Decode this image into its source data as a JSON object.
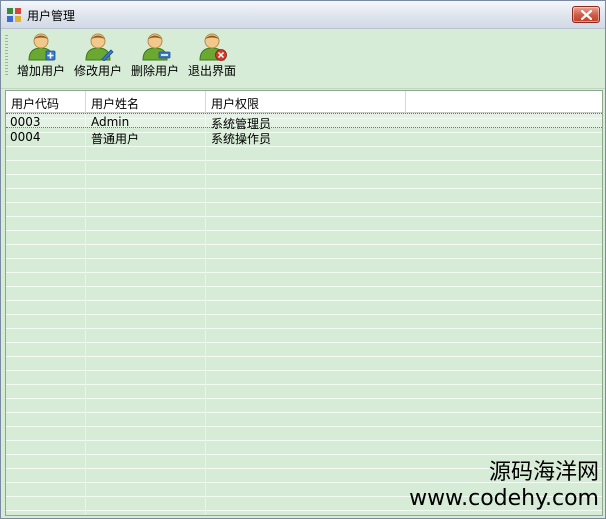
{
  "window": {
    "title": "用户管理"
  },
  "toolbar": {
    "buttons": [
      {
        "label": "增加用户",
        "icon": "user-add-icon"
      },
      {
        "label": "修改用户",
        "icon": "user-edit-icon"
      },
      {
        "label": "删除用户",
        "icon": "user-delete-icon"
      },
      {
        "label": "退出界面",
        "icon": "user-exit-icon"
      }
    ]
  },
  "table": {
    "columns": [
      "用户代码",
      "用户姓名",
      "用户权限"
    ],
    "rows": [
      [
        "0003",
        "Admin",
        "系统管理员"
      ],
      [
        "0004",
        "普通用户",
        "系统操作员"
      ]
    ]
  },
  "watermark": {
    "line1": "源码海洋网",
    "line2": "www.codehy.com"
  },
  "colors": {
    "background": "#d6ecd6",
    "close": "#c94a33",
    "user_green": "#6aa832",
    "user_face": "#f3c98b"
  }
}
